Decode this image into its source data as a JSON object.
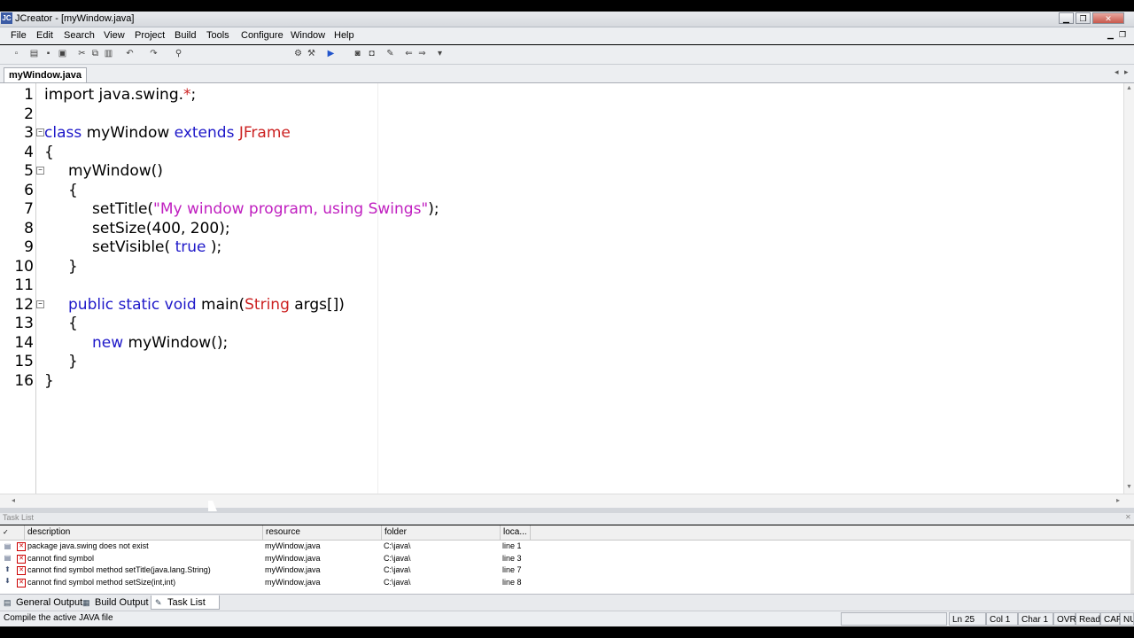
{
  "window": {
    "title": "JCreator - [myWindow.java]",
    "app_icon_text": "JC"
  },
  "menu": {
    "file": "File",
    "edit": "Edit",
    "search": "Search",
    "view": "View",
    "project": "Project",
    "build": "Build",
    "tools": "Tools",
    "configure": "Configure",
    "window": "Window",
    "help": "Help"
  },
  "tabs": {
    "document": "myWindow.java"
  },
  "editor": {
    "line_numbers": [
      "1",
      "2",
      "3",
      "4",
      "5",
      "6",
      "7",
      "8",
      "9",
      "10",
      "11",
      "12",
      "13",
      "14",
      "15",
      "16"
    ],
    "lines": [
      [
        "import java.swing.",
        "*",
        ";"
      ],
      [],
      [
        "class",
        " myWindow ",
        "extends",
        " ",
        "JFrame"
      ],
      [
        "{"
      ],
      [
        "myWindow()"
      ],
      [
        "{"
      ],
      [
        "setTitle(",
        "\"My window program, using Swings\"",
        ");"
      ],
      [
        "setSize(400, 200);"
      ],
      [
        "setVisible( ",
        "true",
        " );"
      ],
      [
        "}"
      ],
      [],
      [
        "public static void",
        " main(",
        "String",
        " args[])"
      ],
      [
        "{"
      ],
      [
        "new",
        " myWindow();"
      ],
      [
        "}"
      ],
      [
        "}"
      ]
    ]
  },
  "tasklist": {
    "pane_title": "Task List",
    "columns": [
      "description",
      "resource",
      "folder",
      "loca..."
    ],
    "rows": [
      [
        "package java.swing does not exist",
        "myWindow.java",
        "C:\\java\\",
        "line 1"
      ],
      [
        "cannot find symbol",
        "myWindow.java",
        "C:\\java\\",
        "line 3"
      ],
      [
        "cannot find symbol method setTitle(java.lang.String)",
        "myWindow.java",
        "C:\\java\\",
        "line 7"
      ],
      [
        "cannot find symbol method setSize(int,int)",
        "myWindow.java",
        "C:\\java\\",
        "line 8"
      ]
    ]
  },
  "bottom_tabs": {
    "general_output": "General Output",
    "build_output": "Build Output",
    "task_list": "Task List"
  },
  "status": {
    "message": "Compile the active JAVA file",
    "ln": "Ln 25",
    "col": "Col 1",
    "char": "Char 1",
    "ovr": "OVR",
    "read": "Read",
    "cap": "CAP",
    "num": "NUM"
  },
  "icons": {
    "error": "error-icon",
    "minimize": "minimize-icon",
    "maximize": "maximize-icon",
    "close": "close-icon"
  }
}
